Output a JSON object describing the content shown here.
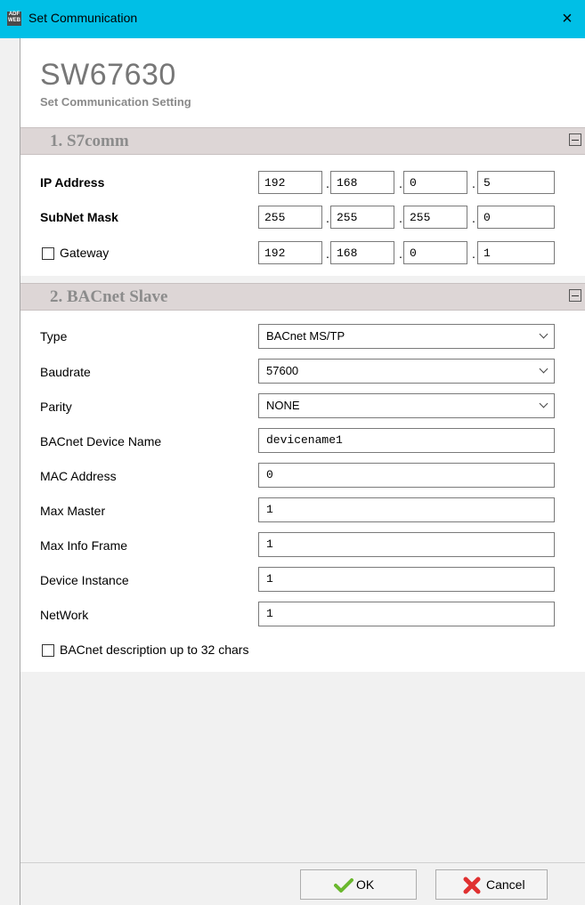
{
  "window": {
    "title": "Set Communication",
    "close_glyph": "×",
    "app_icon_text": "ADF WEB"
  },
  "header": {
    "product": "SW67630",
    "subtitle": "Set Communication Setting"
  },
  "section1": {
    "title": "1. S7comm",
    "ip_label": "IP Address",
    "ip": [
      "192",
      "168",
      "0",
      "5"
    ],
    "mask_label": "SubNet Mask",
    "mask": [
      "255",
      "255",
      "255",
      "0"
    ],
    "gateway_label": "Gateway",
    "gateway_checked": false,
    "gateway": [
      "192",
      "168",
      "0",
      "1"
    ]
  },
  "section2": {
    "title": "2. BACnet Slave",
    "type_label": "Type",
    "type_value": "BACnet MS/TP",
    "baud_label": "Baudrate",
    "baud_value": "57600",
    "parity_label": "Parity",
    "parity_value": "NONE",
    "devname_label": "BACnet Device Name",
    "devname_value": "devicename1",
    "mac_label": "MAC Address",
    "mac_value": "0",
    "maxmaster_label": "Max Master",
    "maxmaster_value": "1",
    "maxinfo_label": "Max Info Frame",
    "maxinfo_value": "1",
    "devinst_label": "Device Instance",
    "devinst_value": "1",
    "network_label": "NetWork",
    "network_value": "1",
    "desc_label": "BACnet description up to 32 chars",
    "desc_checked": false
  },
  "buttons": {
    "ok_label": "OK",
    "cancel_label": "Cancel"
  },
  "colors": {
    "titlebar": "#00bfe6",
    "section_bar": "#ddd6d6",
    "ok_icon": "#6ab82e",
    "cancel_icon": "#e03030"
  },
  "icons": {
    "ok": "check-icon",
    "cancel": "x-icon",
    "collapse": "collapse-icon"
  }
}
